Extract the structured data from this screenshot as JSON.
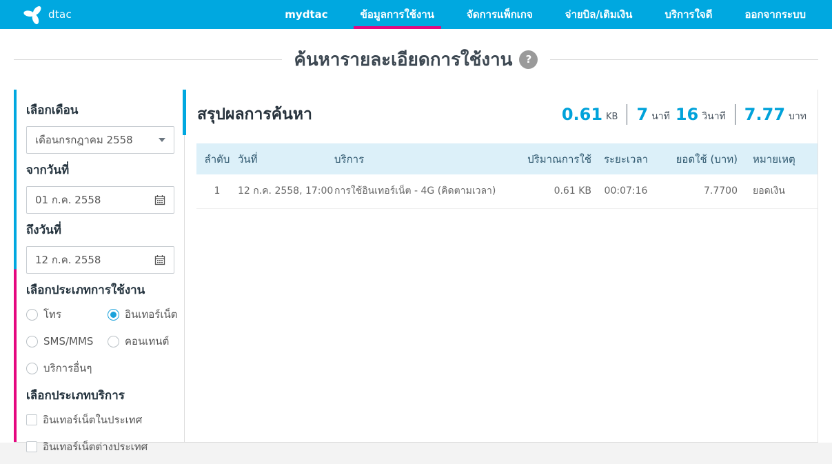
{
  "colors": {
    "brand_blue": "#00a8e0",
    "accent_pink": "#e5077f",
    "value_blue": "#00a2da",
    "table_header_bg": "#dcf0f9"
  },
  "brand": {
    "logo_text": "dtac"
  },
  "navbar": {
    "items": [
      {
        "label": "mydtac",
        "active": false
      },
      {
        "label": "ข้อมูลการใช้งาน",
        "active": true
      },
      {
        "label": "จัดการแพ็กเกจ",
        "active": false
      },
      {
        "label": "จ่ายบิล/เติมเงิน",
        "active": false
      },
      {
        "label": "บริการใจดี",
        "active": false
      },
      {
        "label": "ออกจากระบบ",
        "active": false
      }
    ]
  },
  "page": {
    "title": "ค้นหารายละเอียดการใช้งาน",
    "help_glyph": "?"
  },
  "filters": {
    "month": {
      "label": "เลือกเดือน",
      "value": "เดือนกรกฎาคม 2558"
    },
    "from_date": {
      "label": "จากวันที่",
      "value": "01 ก.ค. 2558"
    },
    "to_date": {
      "label": "ถึงวันที่",
      "value": "12 ก.ค. 2558"
    },
    "usage_type": {
      "label": "เลือกประเภทการใช้งาน",
      "options": [
        {
          "label": "โทร",
          "checked": false
        },
        {
          "label": "อินเทอร์เน็ต",
          "checked": true
        },
        {
          "label": "SMS/MMS",
          "checked": false
        },
        {
          "label": "คอนเทนต์",
          "checked": false
        },
        {
          "label": "บริการอื่นๆ",
          "checked": false
        }
      ]
    },
    "service_type": {
      "label": "เลือกประเภทบริการ",
      "options": [
        {
          "label": "อินเทอร์เน็ตในประเทศ",
          "checked": false
        },
        {
          "label": "อินเทอร์เน็ตต่างประเทศ",
          "checked": false
        }
      ]
    }
  },
  "results": {
    "title": "สรุปผลการค้นหา",
    "summary": {
      "data_value": "0.61",
      "data_unit": "KB",
      "minutes": "7",
      "minutes_unit": "นาที",
      "seconds": "16",
      "seconds_unit": "วินาที",
      "amount": "7.77",
      "amount_unit": "บาท"
    },
    "table": {
      "headers": [
        "ลำดับ",
        "วันที่",
        "บริการ",
        "ปริมาณการใช้",
        "ระยะเวลา",
        "ยอดใช้ (บาท)",
        "หมายเหตุ"
      ],
      "rows": [
        [
          "1",
          "12 ก.ค. 2558, 17:00",
          "การใช้อินเทอร์เน็ต - 4G (คิดตามเวลา)",
          "0.61 KB",
          "00:07:16",
          "7.7700",
          "ยอดเงิน"
        ]
      ]
    }
  }
}
